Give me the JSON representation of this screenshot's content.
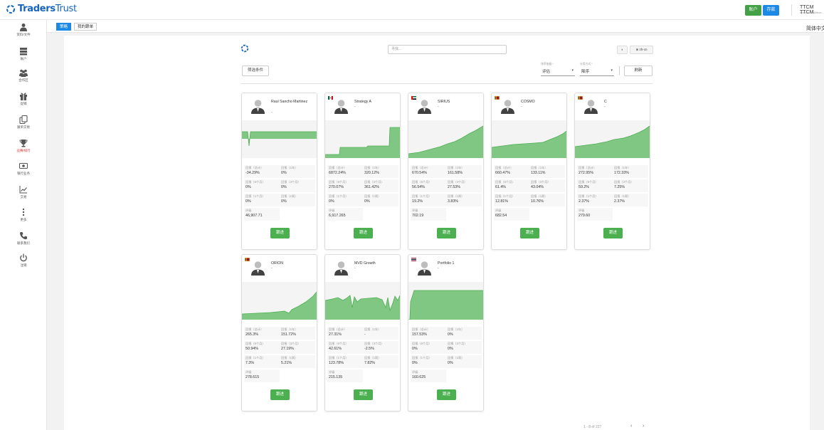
{
  "app": {
    "logo_main": "Traders",
    "logo_sub": "Trust",
    "account_button": "账户",
    "deposit_button": "存款",
    "user_name": "TTCM TTCM",
    "user_email": "operations@ttcm...",
    "language": "简体中文"
  },
  "sidebar": {
    "items": [
      {
        "label": "资料/文件",
        "icon": "user-icon"
      },
      {
        "label": "账户",
        "icon": "server-icon"
      },
      {
        "label": "合作区",
        "icon": "group-icon"
      },
      {
        "label": "促销",
        "icon": "gift-icon"
      },
      {
        "label": "跟单交易",
        "icon": "copy-icon"
      },
      {
        "label": "竞赛/排行",
        "icon": "trophy-icon"
      },
      {
        "label": "银行业务",
        "icon": "money-icon"
      },
      {
        "label": "交易",
        "icon": "chart-icon"
      },
      {
        "label": "更多",
        "icon": "more-icon"
      },
      {
        "label": "联系我们",
        "icon": "phone-icon"
      },
      {
        "label": "注销",
        "icon": "power-icon"
      }
    ]
  },
  "tabs": [
    "策略",
    "我的跟单"
  ],
  "toolbar": {
    "search_placeholder": "寻找...",
    "theme_toggle": "◐",
    "locale": "zh-cn",
    "filter_button": "筛选条件",
    "sort_field_label": "排序依据 *",
    "sort_field_value": "评估",
    "sort_order_label": "分类方式 *",
    "sort_order_value": "降序",
    "refresh_button": "刷新"
  },
  "stat_labels": {
    "total": "回报（总计）",
    "y1": "回报（1年）",
    "m6": "回报（6个月）",
    "m3": "回报（3个月）",
    "m1": "回报（1个月）",
    "w1": "回报（1周）",
    "rating": "评级"
  },
  "follow_label": "跟进",
  "cards": [
    {
      "name": "Raul Sancho Martinez",
      "sub": "-",
      "flag": "none",
      "total": "-34.29%",
      "y1": "0%",
      "m6": "0%",
      "m3": "0%",
      "m1": "0%",
      "w1": "0%",
      "rating": "46,907.71"
    },
    {
      "name": "Strategy A",
      "sub": "-",
      "flag": "mexico",
      "total": "6872.24%",
      "y1": "320.12%",
      "m6": "270.07%",
      "m3": "361.42%",
      "m1": "0%",
      "w1": "0%",
      "rating": "6,917.265"
    },
    {
      "name": "SIRIUS",
      "sub": "-",
      "flag": "uae",
      "total": "670.54%",
      "y1": "161.58%",
      "m6": "56.54%",
      "m3": "27.53%",
      "m1": "19.2%",
      "w1": "3.83%",
      "rating": "702.19"
    },
    {
      "name": "COSMO",
      "sub": "-",
      "flag": "sri-lanka",
      "total": "660.47%",
      "y1": "133.11%",
      "m6": "61.4%",
      "m3": "43.04%",
      "m1": "12.81%",
      "w1": "10.76%",
      "rating": "682.54"
    },
    {
      "name": "C",
      "sub": "-",
      "flag": "sri-lanka",
      "total": "272.95%",
      "y1": "172.33%",
      "m6": "59.2%",
      "m3": "7.25%",
      "m1": "2.37%",
      "w1": "2.37%",
      "rating": "279.60"
    },
    {
      "name": "ORION",
      "sub": "-",
      "flag": "sri-lanka",
      "total": "265.3%",
      "y1": "151.72%",
      "m6": "50.94%",
      "m3": "27.19%",
      "m1": "7.3%",
      "w1": "5.21%",
      "rating": "278.615"
    },
    {
      "name": "MVD Growth",
      "sub": "-",
      "flag": "none",
      "total": "27.31%",
      "y1": "-",
      "m6": "42.61%",
      "m3": "-2.5%",
      "m1": "123.78%",
      "w1": "7.82%",
      "rating": "215.135"
    },
    {
      "name": "Portfolio 1",
      "sub": "-",
      "flag": "thailand",
      "total": "157.53%",
      "y1": "0%",
      "m6": "0%",
      "m3": "0%",
      "m1": "0%",
      "w1": "0%",
      "rating": "160.625"
    }
  ],
  "pagination": {
    "text": "1 - 8 of 227",
    "prev": "‹",
    "next": "›"
  },
  "colors": {
    "primary": "#1e88e5",
    "success": "#4caf50",
    "chart_fill": "#81c784",
    "chart_line": "#4caf50"
  }
}
